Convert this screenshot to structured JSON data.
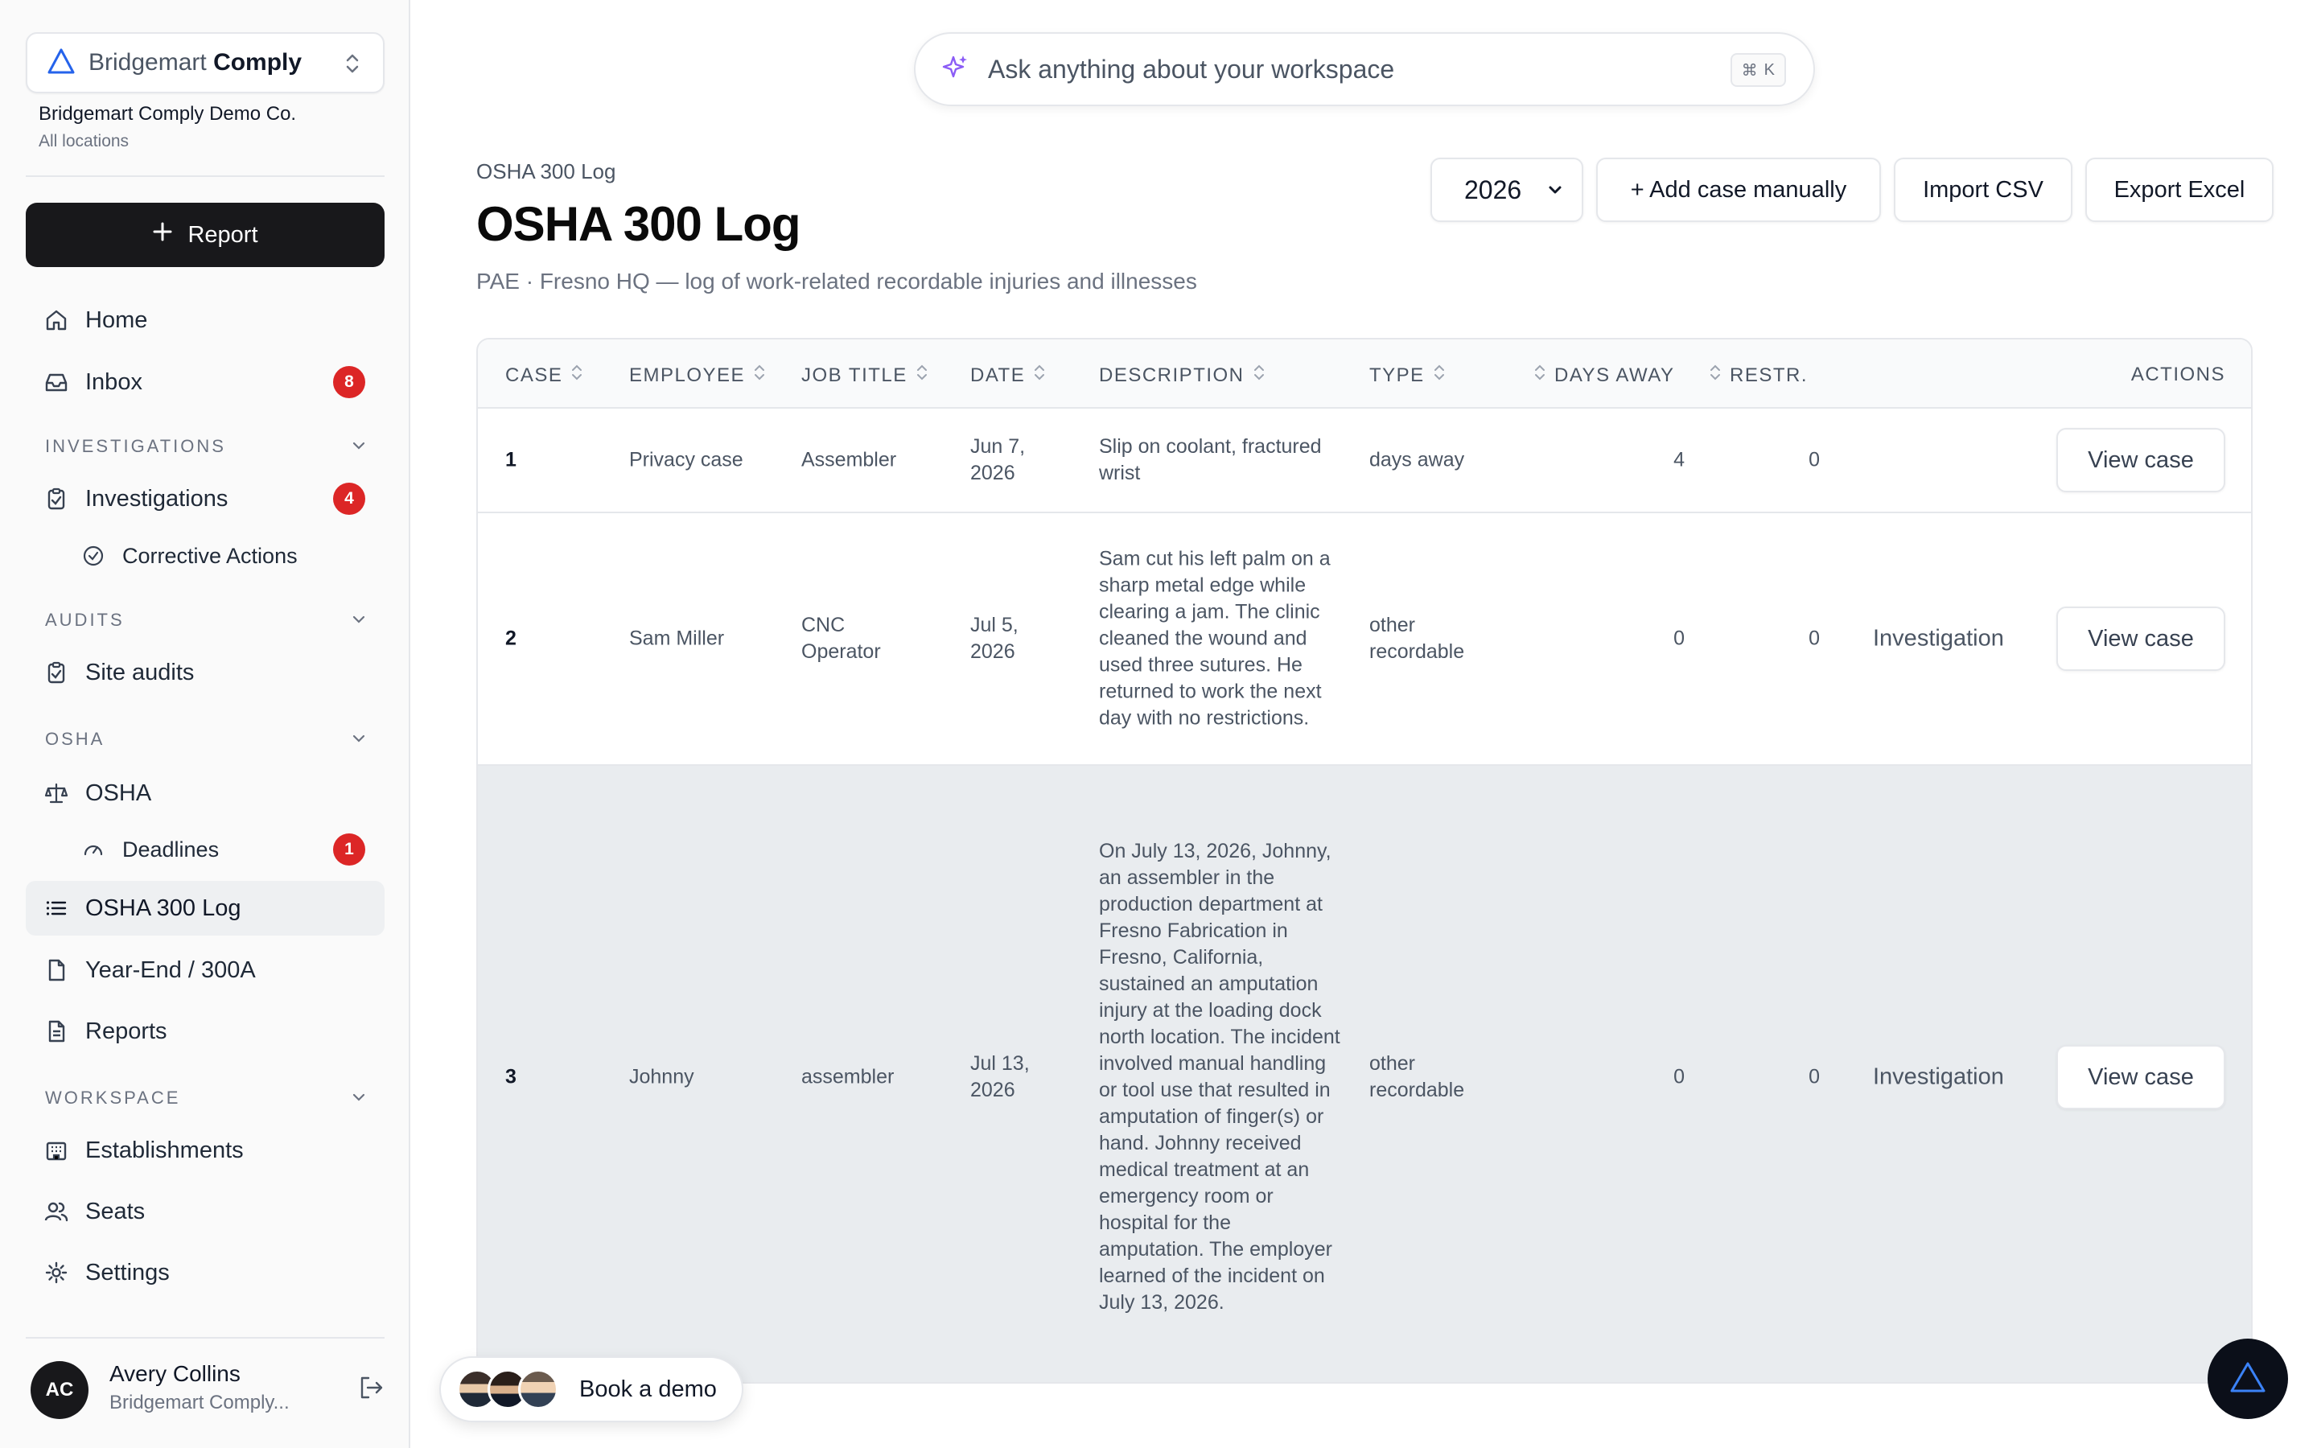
{
  "app": {
    "brand_light": "Bridgemart",
    "brand_bold": "Comply",
    "org_name": "Bridgemart Comply Demo Co.",
    "org_location": "All locations",
    "accent": "#18181b",
    "badge_color": "#dc2626"
  },
  "sidebar": {
    "report_label": "Report",
    "home": "Home",
    "inbox": "Inbox",
    "inbox_count": "8",
    "sec_investigations": "INVESTIGATIONS",
    "investigations": "Investigations",
    "investigations_count": "4",
    "corrective_actions": "Corrective Actions",
    "sec_audits": "AUDITS",
    "site_audits": "Site audits",
    "sec_osha": "OSHA",
    "osha": "OSHA",
    "deadlines": "Deadlines",
    "deadlines_count": "1",
    "osha_300_log": "OSHA 300 Log",
    "year_end": "Year-End / 300A",
    "reports": "Reports",
    "sec_workspace": "WORKSPACE",
    "establishments": "Establishments",
    "seats": "Seats",
    "settings": "Settings"
  },
  "user": {
    "initials": "AC",
    "name": "Avery Collins",
    "org": "Bridgemart Comply..."
  },
  "search": {
    "placeholder": "Ask anything about your workspace",
    "shortcut_symbol": "⌘",
    "shortcut_key": "K"
  },
  "page": {
    "breadcrumb": "OSHA 300 Log",
    "title": "OSHA 300 Log",
    "subtitle": "PAE · Fresno HQ — log of work-related recordable injuries and illnesses",
    "year": "2026",
    "add_case": "+ Add case manually",
    "import_csv": "Import CSV",
    "export_excel": "Export Excel"
  },
  "table": {
    "headers": {
      "case": "CASE",
      "employee": "EMPLOYEE",
      "job_title": "JOB TITLE",
      "date": "DATE",
      "description": "DESCRIPTION",
      "type": "TYPE",
      "days_away": "DAYS AWAY",
      "restr": "RESTR.",
      "actions": "ACTIONS"
    },
    "view_label": "View case",
    "rows": [
      {
        "case": "1",
        "employee": "Privacy case",
        "job_title": "Assembler",
        "date": "Jun 7, 2026",
        "description": "Slip on coolant, fractured wrist",
        "type": "days away",
        "days_away": "4",
        "restr": "0",
        "source": ""
      },
      {
        "case": "2",
        "employee": "Sam Miller",
        "job_title": "CNC Operator",
        "date": "Jul 5, 2026",
        "description": "Sam cut his left palm on a sharp metal edge while clearing a jam. The clinic cleaned the wound and used three sutures. He returned to work the next day with no restrictions.",
        "type": "other recordable",
        "days_away": "0",
        "restr": "0",
        "source": "Investigation"
      },
      {
        "case": "3",
        "employee": "Johnny",
        "job_title": "assembler",
        "date": "Jul 13, 2026",
        "description": "On July 13, 2026, Johnny, an assembler in the production department at Fresno Fabrication in Fresno, California, sustained an amputation injury at the loading dock north location. The incident involved manual handling or tool use that resulted in amputation of finger(s) or hand. Johnny received medical treatment at an emergency room or hospital for the amputation. The employer learned of the incident on July 13, 2026.",
        "type": "other recordable",
        "days_away": "0",
        "restr": "0",
        "source": "Investigation"
      }
    ]
  },
  "demo": {
    "label": "Book a demo"
  }
}
